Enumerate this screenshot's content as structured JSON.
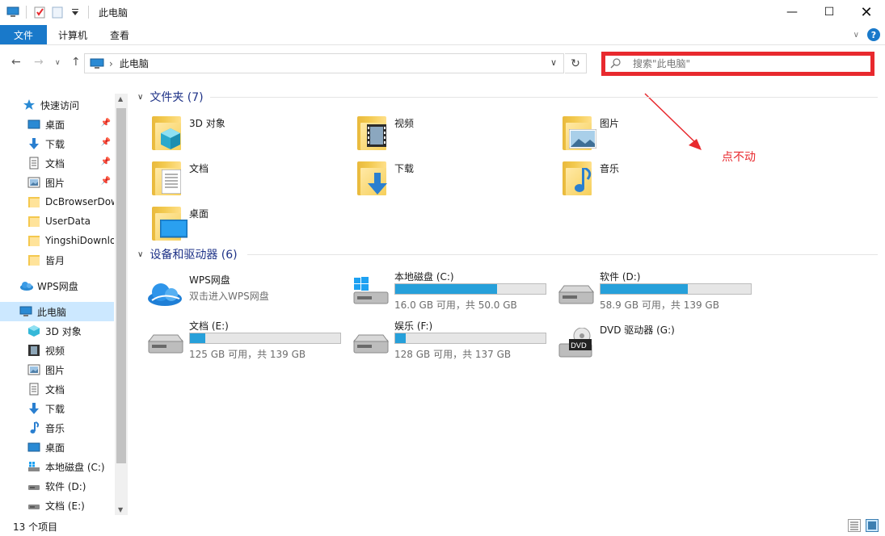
{
  "window": {
    "title": "此电脑",
    "minimize": "—",
    "maximize": "☐",
    "close": "✕"
  },
  "ribbon": {
    "tabs": [
      "文件",
      "计算机",
      "查看"
    ],
    "help": "?"
  },
  "address": {
    "path": "此电脑",
    "separator": "›",
    "search_placeholder": "搜索\"此电脑\""
  },
  "sidebar": {
    "items": [
      {
        "label": "快速访问",
        "icon": "star-icon",
        "pinned": false
      },
      {
        "label": "桌面",
        "icon": "desktop-icon",
        "pinned": true
      },
      {
        "label": "下载",
        "icon": "download-icon",
        "pinned": true
      },
      {
        "label": "文档",
        "icon": "document-icon",
        "pinned": true
      },
      {
        "label": "图片",
        "icon": "picture-icon",
        "pinned": true
      },
      {
        "label": "DcBrowserDow",
        "icon": "folder-icon",
        "pinned": false
      },
      {
        "label": "UserData",
        "icon": "folder-icon",
        "pinned": false
      },
      {
        "label": "YingshiDownlo",
        "icon": "folder-icon",
        "pinned": false
      },
      {
        "label": "皆月",
        "icon": "folder-icon",
        "pinned": false
      },
      {
        "label": "WPS网盘",
        "icon": "cloud-icon",
        "pinned": false
      },
      {
        "label": "此电脑",
        "icon": "computer-icon",
        "pinned": false,
        "selected": true
      },
      {
        "label": "3D 对象",
        "icon": "cube-icon",
        "pinned": false
      },
      {
        "label": "视频",
        "icon": "video-icon",
        "pinned": false
      },
      {
        "label": "图片",
        "icon": "picture-icon",
        "pinned": false
      },
      {
        "label": "文档",
        "icon": "document-icon",
        "pinned": false
      },
      {
        "label": "下载",
        "icon": "download-icon",
        "pinned": false
      },
      {
        "label": "音乐",
        "icon": "music-icon",
        "pinned": false
      },
      {
        "label": "桌面",
        "icon": "desktop-icon",
        "pinned": false
      },
      {
        "label": "本地磁盘 (C:)",
        "icon": "drive-icon",
        "pinned": false
      },
      {
        "label": "软件 (D:)",
        "icon": "drive-icon",
        "pinned": false
      },
      {
        "label": "文档 (E:)",
        "icon": "drive-icon",
        "pinned": false
      }
    ]
  },
  "content": {
    "folders_header": "文件夹 (7)",
    "folders": [
      {
        "name": "3D 对象",
        "icon": "cube-icon"
      },
      {
        "name": "视频",
        "icon": "video-icon"
      },
      {
        "name": "图片",
        "icon": "picture-icon"
      },
      {
        "name": "文档",
        "icon": "document-icon"
      },
      {
        "name": "下载",
        "icon": "download-icon"
      },
      {
        "name": "音乐",
        "icon": "music-icon"
      },
      {
        "name": "桌面",
        "icon": "desktop-icon"
      }
    ],
    "devices_header": "设备和驱动器 (6)",
    "devices": [
      {
        "name": "WPS网盘",
        "subtitle": "双击进入WPS网盘",
        "icon": "cloud-icon"
      },
      {
        "name": "本地磁盘 (C:)",
        "free": "16.0 GB 可用，共 50.0 GB",
        "used_fraction": 0.68,
        "icon": "windows-drive-icon"
      },
      {
        "name": "软件 (D:)",
        "free": "58.9 GB 可用，共 139 GB",
        "used_fraction": 0.58,
        "icon": "drive-icon"
      },
      {
        "name": "文档 (E:)",
        "free": "125 GB 可用，共 139 GB",
        "used_fraction": 0.1,
        "icon": "drive-icon"
      },
      {
        "name": "娱乐 (F:)",
        "free": "128 GB 可用，共 137 GB",
        "used_fraction": 0.07,
        "icon": "drive-icon"
      },
      {
        "name": "DVD 驱动器 (G:)",
        "icon": "dvd-icon"
      }
    ]
  },
  "annotation": "点不动",
  "status": {
    "count": "13 个项目"
  },
  "colors": {
    "accent": "#1979ca",
    "highlight": "#e8292e",
    "bar_fill": "#26a0da",
    "selected_bg": "#cce8ff",
    "group_header": "#1e3287"
  }
}
